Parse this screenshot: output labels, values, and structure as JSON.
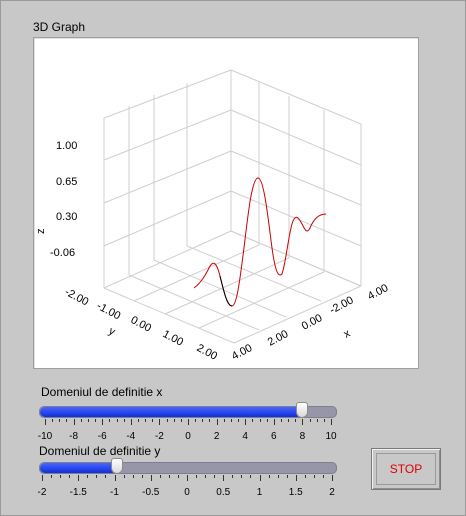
{
  "graph": {
    "title": "3D Graph",
    "axes": {
      "x": {
        "label": "x",
        "ticks": [
          "4.00",
          "2.00",
          "0.00",
          "-2.00",
          "4.00"
        ]
      },
      "y": {
        "label": "y",
        "ticks": [
          "-2.00",
          "-1.00",
          "0.00",
          "1.00",
          "2.00"
        ]
      },
      "z": {
        "label": "z",
        "ticks": [
          "1.00",
          "0.65",
          "0.30",
          "-0.06"
        ]
      }
    },
    "curve_color": "#cc0000"
  },
  "slider_x": {
    "label": "Domeniul de definitie x",
    "min": -10,
    "max": 10,
    "value": 8,
    "ticks": [
      "-10",
      "-8",
      "-6",
      "-4",
      "-2",
      "0",
      "2",
      "4",
      "6",
      "8",
      "10"
    ]
  },
  "slider_y": {
    "label": "Domeniul de definitie y",
    "min": -2,
    "max": 2,
    "value": -1,
    "ticks": [
      "-2",
      "-1.5",
      "-1",
      "-0.5",
      "0",
      "0.5",
      "1",
      "1.5",
      "2"
    ]
  },
  "stop_button": {
    "label": "STOP",
    "color": "#e00000"
  },
  "colors": {
    "slider_fill": "#1a3cf0",
    "panel": "#c8c8c8"
  }
}
